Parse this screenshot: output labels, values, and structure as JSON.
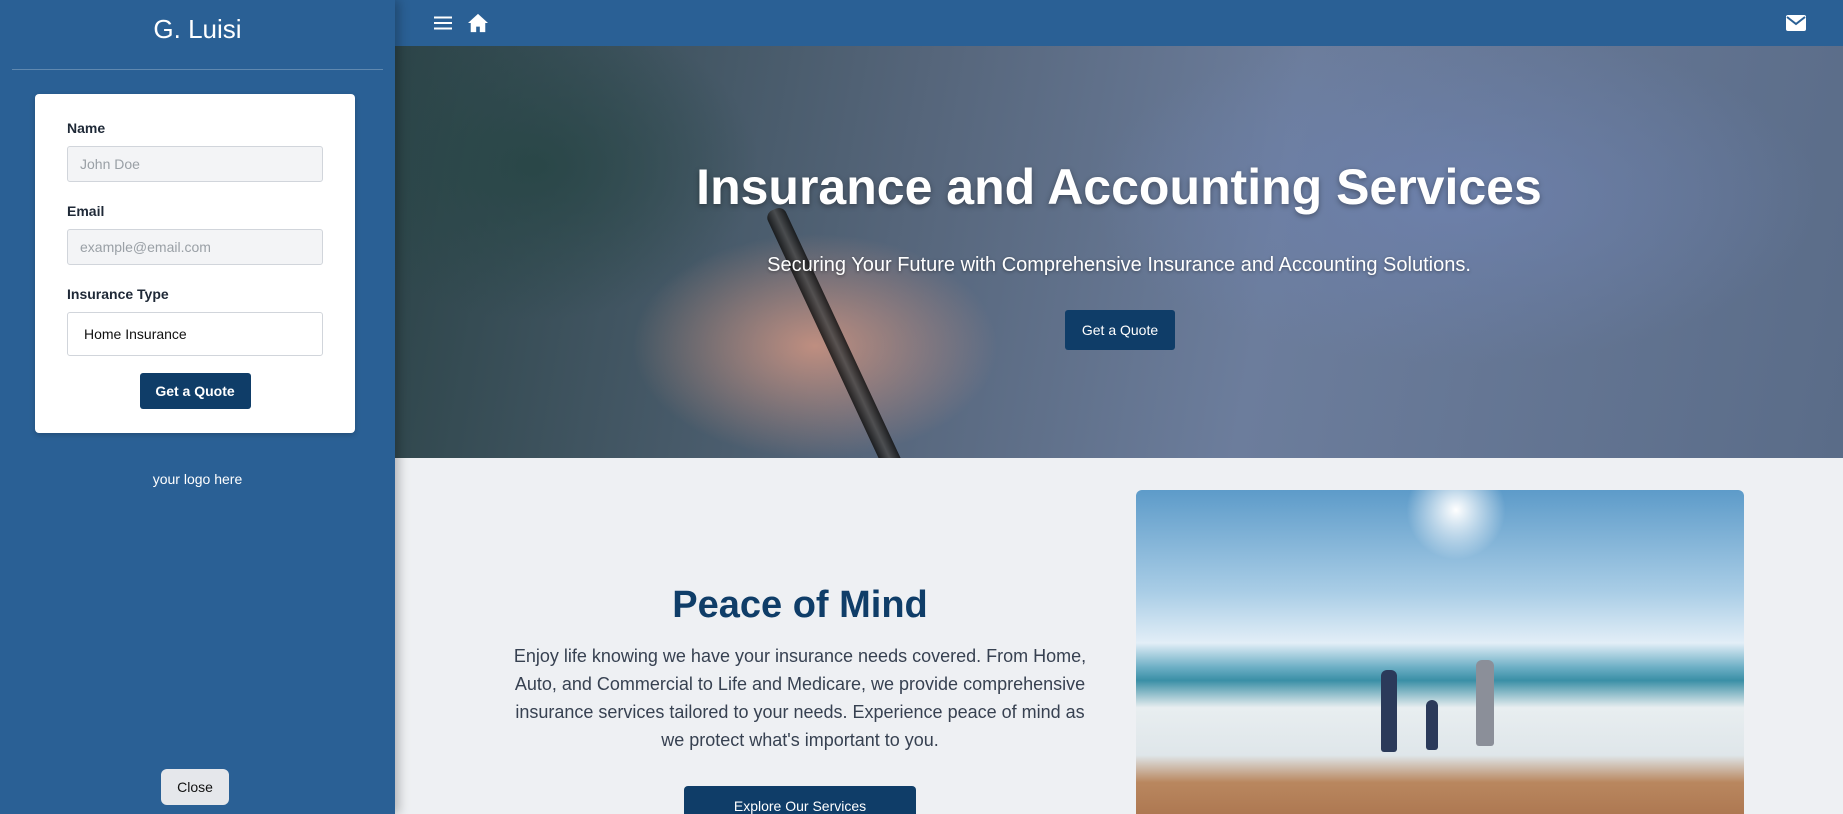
{
  "sidebar": {
    "title": "G. Luisi",
    "form": {
      "name_label": "Name",
      "name_placeholder": "John Doe",
      "email_label": "Email",
      "email_placeholder": "example@email.com",
      "type_label": "Insurance Type",
      "type_value": "Home Insurance",
      "submit_label": "Get a Quote"
    },
    "logo_text": "your logo here",
    "close_label": "Close"
  },
  "topbar": {
    "menu_icon": "menu-icon",
    "home_icon": "home-icon",
    "mail_icon": "mail-icon"
  },
  "hero": {
    "title": "Insurance and Accounting Services",
    "subtitle": "Securing Your Future with Comprehensive Insurance and Accounting Solutions.",
    "cta_label": "Get a Quote"
  },
  "content": {
    "title": "Peace of Mind",
    "text": "Enjoy life knowing we have your insurance needs covered. From Home, Auto, and Commercial to Life and Medicare, we provide comprehensive insurance services tailored to your needs. Experience peace of mind as we protect what's important to you.",
    "cta_label": "Explore Our Services"
  },
  "colors": {
    "primary": "#2a6095",
    "dark_primary": "#0f3d68",
    "background": "#eef0f3"
  }
}
